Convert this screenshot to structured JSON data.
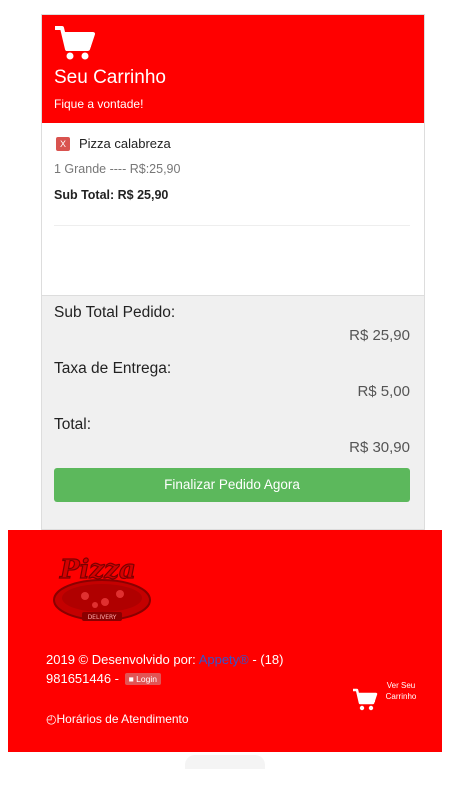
{
  "cart": {
    "title": "Seu Carrinho",
    "subtitle": "Fique a vontade!",
    "icon": "shopping-cart-icon"
  },
  "items": [
    {
      "remove_label": "X",
      "name": "Pizza calabreza",
      "size_line": "1 Grande ---- R$:25,90",
      "subtotal_line": "Sub Total: R$ 25,90"
    }
  ],
  "summary": {
    "subtotal_label": "Sub Total Pedido:",
    "subtotal_value": "R$ 25,90",
    "delivery_label": "Taxa de Entrega:",
    "delivery_value": "R$ 5,00",
    "total_label": "Total:",
    "total_value": "R$ 30,90",
    "checkout_label": "Finalizar Pedido Agora"
  },
  "footer": {
    "logo_text": "Pizza",
    "logo_subtext": "DELIVERY",
    "credit_prefix": "2019 © Desenvolvido por: ",
    "credit_link": "Appety®",
    "credit_suffix": " - (18)",
    "phone": "981651446 - ",
    "login_label": "Login",
    "hours_label": "Horários de Atendimento",
    "view_cart_label": "Ver Seu Carrinho"
  },
  "colors": {
    "brand_red": "#ff0000",
    "checkout_green": "#5cb85c",
    "link_blue": "#3355cc"
  }
}
